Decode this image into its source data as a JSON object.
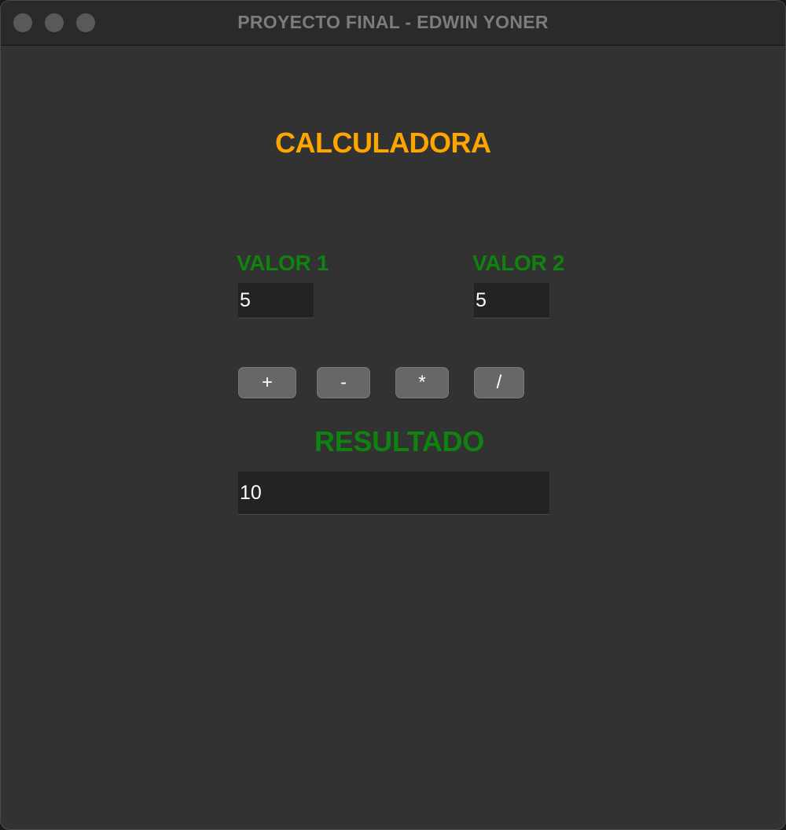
{
  "window": {
    "title": "PROYECTO FINAL - EDWIN YONER"
  },
  "app": {
    "title": "CALCULADORA"
  },
  "fields": {
    "valor1_label": "VALOR 1",
    "valor1_value": "5",
    "valor2_label": "VALOR 2",
    "valor2_value": "5",
    "resultado_label": "RESULTADO",
    "resultado_value": "10"
  },
  "buttons": {
    "add": "+",
    "subtract": "-",
    "multiply": "*",
    "divide": "/"
  },
  "colors": {
    "title_accent": "#ffa500",
    "label_green": "#0f820f",
    "background": "#323232",
    "input_background": "#232323",
    "button_background": "#676767"
  }
}
